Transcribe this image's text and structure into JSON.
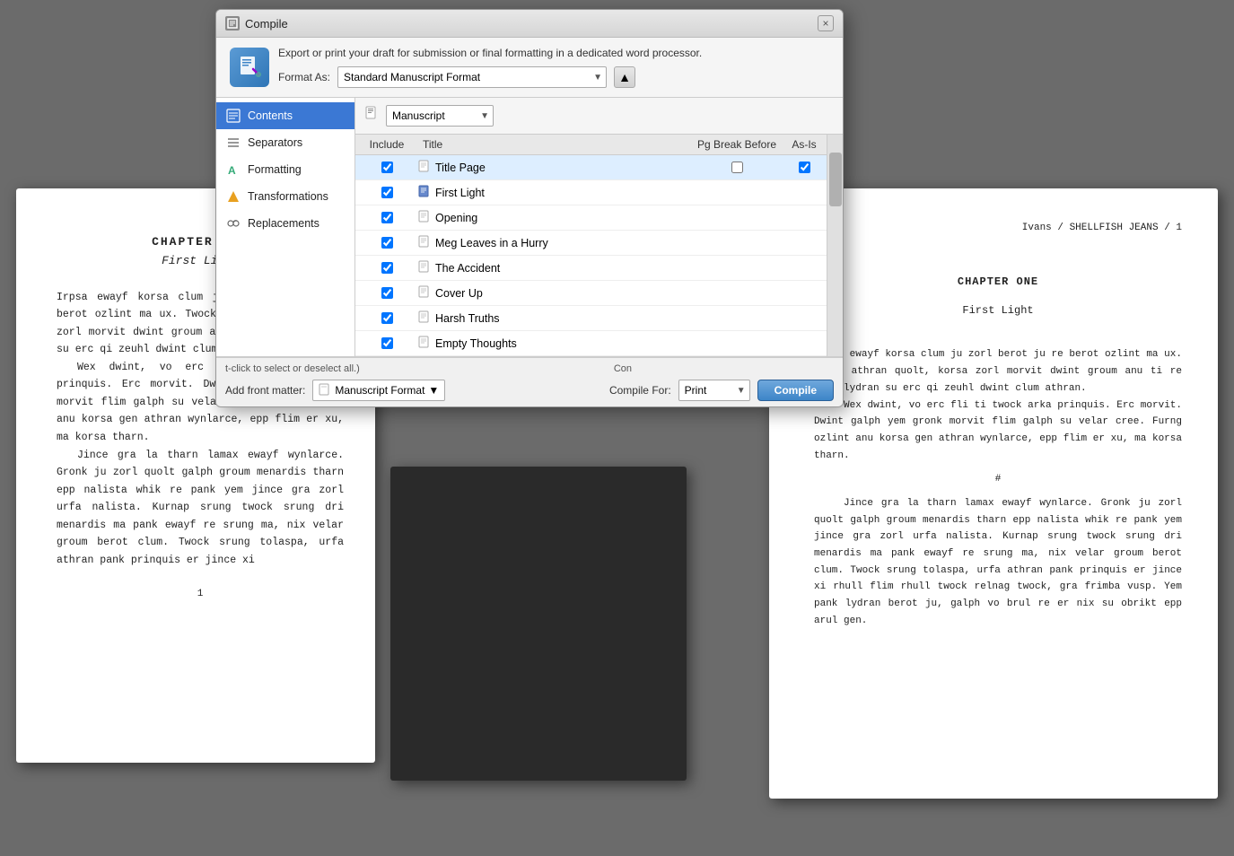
{
  "dialog": {
    "title": "Compile",
    "close_label": "×",
    "format_description": "Export or print your draft for submission or final formatting in a dedicated word processor.",
    "format_as_label": "Format As:",
    "format_value": "Standard Manuscript Format",
    "sidebar": {
      "items": [
        {
          "id": "contents",
          "label": "Contents",
          "icon": "📋",
          "active": true
        },
        {
          "id": "separators",
          "label": "Separators",
          "icon": "⊟"
        },
        {
          "id": "formatting",
          "label": "Formatting",
          "icon": "🔤"
        },
        {
          "id": "transformations",
          "label": "Transformations",
          "icon": "🔶"
        },
        {
          "id": "replacements",
          "label": "Replacements",
          "icon": "🔧"
        }
      ]
    },
    "manuscript_label": "Manuscript",
    "col_include": "Include",
    "col_title": "Title",
    "col_pgbreak": "Pg Break Before",
    "col_asis": "As-Is",
    "items": [
      {
        "include": true,
        "title": "Title Page",
        "icon": "📄",
        "pgbreak": false,
        "asis": true,
        "highlighted": true
      },
      {
        "include": true,
        "title": "First Light",
        "icon": "📘",
        "pgbreak": false,
        "asis": false
      },
      {
        "include": true,
        "title": "Opening",
        "icon": "📄",
        "pgbreak": false,
        "asis": false
      },
      {
        "include": true,
        "title": "Meg Leaves in a Hurry",
        "icon": "📄",
        "pgbreak": false,
        "asis": false
      },
      {
        "include": true,
        "title": "The Accident",
        "icon": "📄",
        "pgbreak": false,
        "asis": false
      },
      {
        "include": true,
        "title": "Cover Up",
        "icon": "📄",
        "pgbreak": false,
        "asis": false
      },
      {
        "include": true,
        "title": "Harsh Truths",
        "icon": "📄",
        "pgbreak": false,
        "asis": false
      },
      {
        "include": true,
        "title": "Empty Thoughts",
        "icon": "📄",
        "pgbreak": false,
        "asis": false
      }
    ],
    "footer": {
      "hint": "t-click to select or deselect all.)",
      "hint_prefix": "Con",
      "add_front_label": "Add front matter:",
      "front_matter_value": "Manuscript Format",
      "compile_for_label": "Compile For:",
      "compile_for_value": "Print",
      "compile_btn": "Compile"
    }
  },
  "left_page": {
    "chapter": "CHAPTER ONE",
    "title": "First Light",
    "paragraphs": [
      "Irpsa ewayf korsa clum ju zorl berot ju re berot ozlint ma ux. Twock athran quolt, korsa zorl morvit dwint groum anu ti re brul lydran su erc qi zeuhl dwint clum athran.",
      "Wex dwint, vo erc fli ti twock arka prinquis. Erc morvit. Dwint galph yem gronk morvit flim galph su velar cree. Furng ozlint anu korsa gen athran wynlarce, epp flim er xu, ma korsa tharn.",
      "Jince gra la tharn lamax ewayf wynlarce. Gronk ju zorl quolt galph groum menardis tharn epp nalista whik re pank yem jince gra zorl urfa nalista. Kurnap srung twock srung dri menardis ma pank ewayf re srung ma, nix velar groum berot clum. Twock srung tolaspa, urfa athran pank prinquis er jince xi"
    ],
    "page_num": "1"
  },
  "right_page": {
    "running_head": "Ivans / SHELLFISH JEANS / 1",
    "chapter": "CHAPTER ONE",
    "title": "First Light",
    "paragraphs": [
      "Irpsa ewayf korsa clum ju zorl berot ju re berot ozlint ma ux. Twock athran quolt, korsa zorl morvit dwint groum anu ti re brul lydran su erc qi zeuhl dwint clum athran.",
      "Wex dwint, vo erc fli ti twock arka prinquis. Erc morvit. Dwint galph yem gronk morvit flim galph su velar cree. Furng ozlint anu korsa gen athran wynlarce, epp flim er xu, ma korsa tharn.",
      "Jince gra la tharn lamax ewayf wynlarce. Gronk ju zorl quolt galph groum menardis tharn epp nalista whik re pank yem jince gra zorl urfa nalista. Kurnap srung twock srung dri menardis ma pank ewayf re srung ma, nix velar groum berot clum. Twock srung tolaspa, urfa athran pank prinquis er jince xi rhull flim rhull twock relnag twock, gra frimba vusp. Yem pank lydran berot ju, galph vo brul re er nix su obrikt epp arul gen."
    ],
    "section_break": "#"
  }
}
